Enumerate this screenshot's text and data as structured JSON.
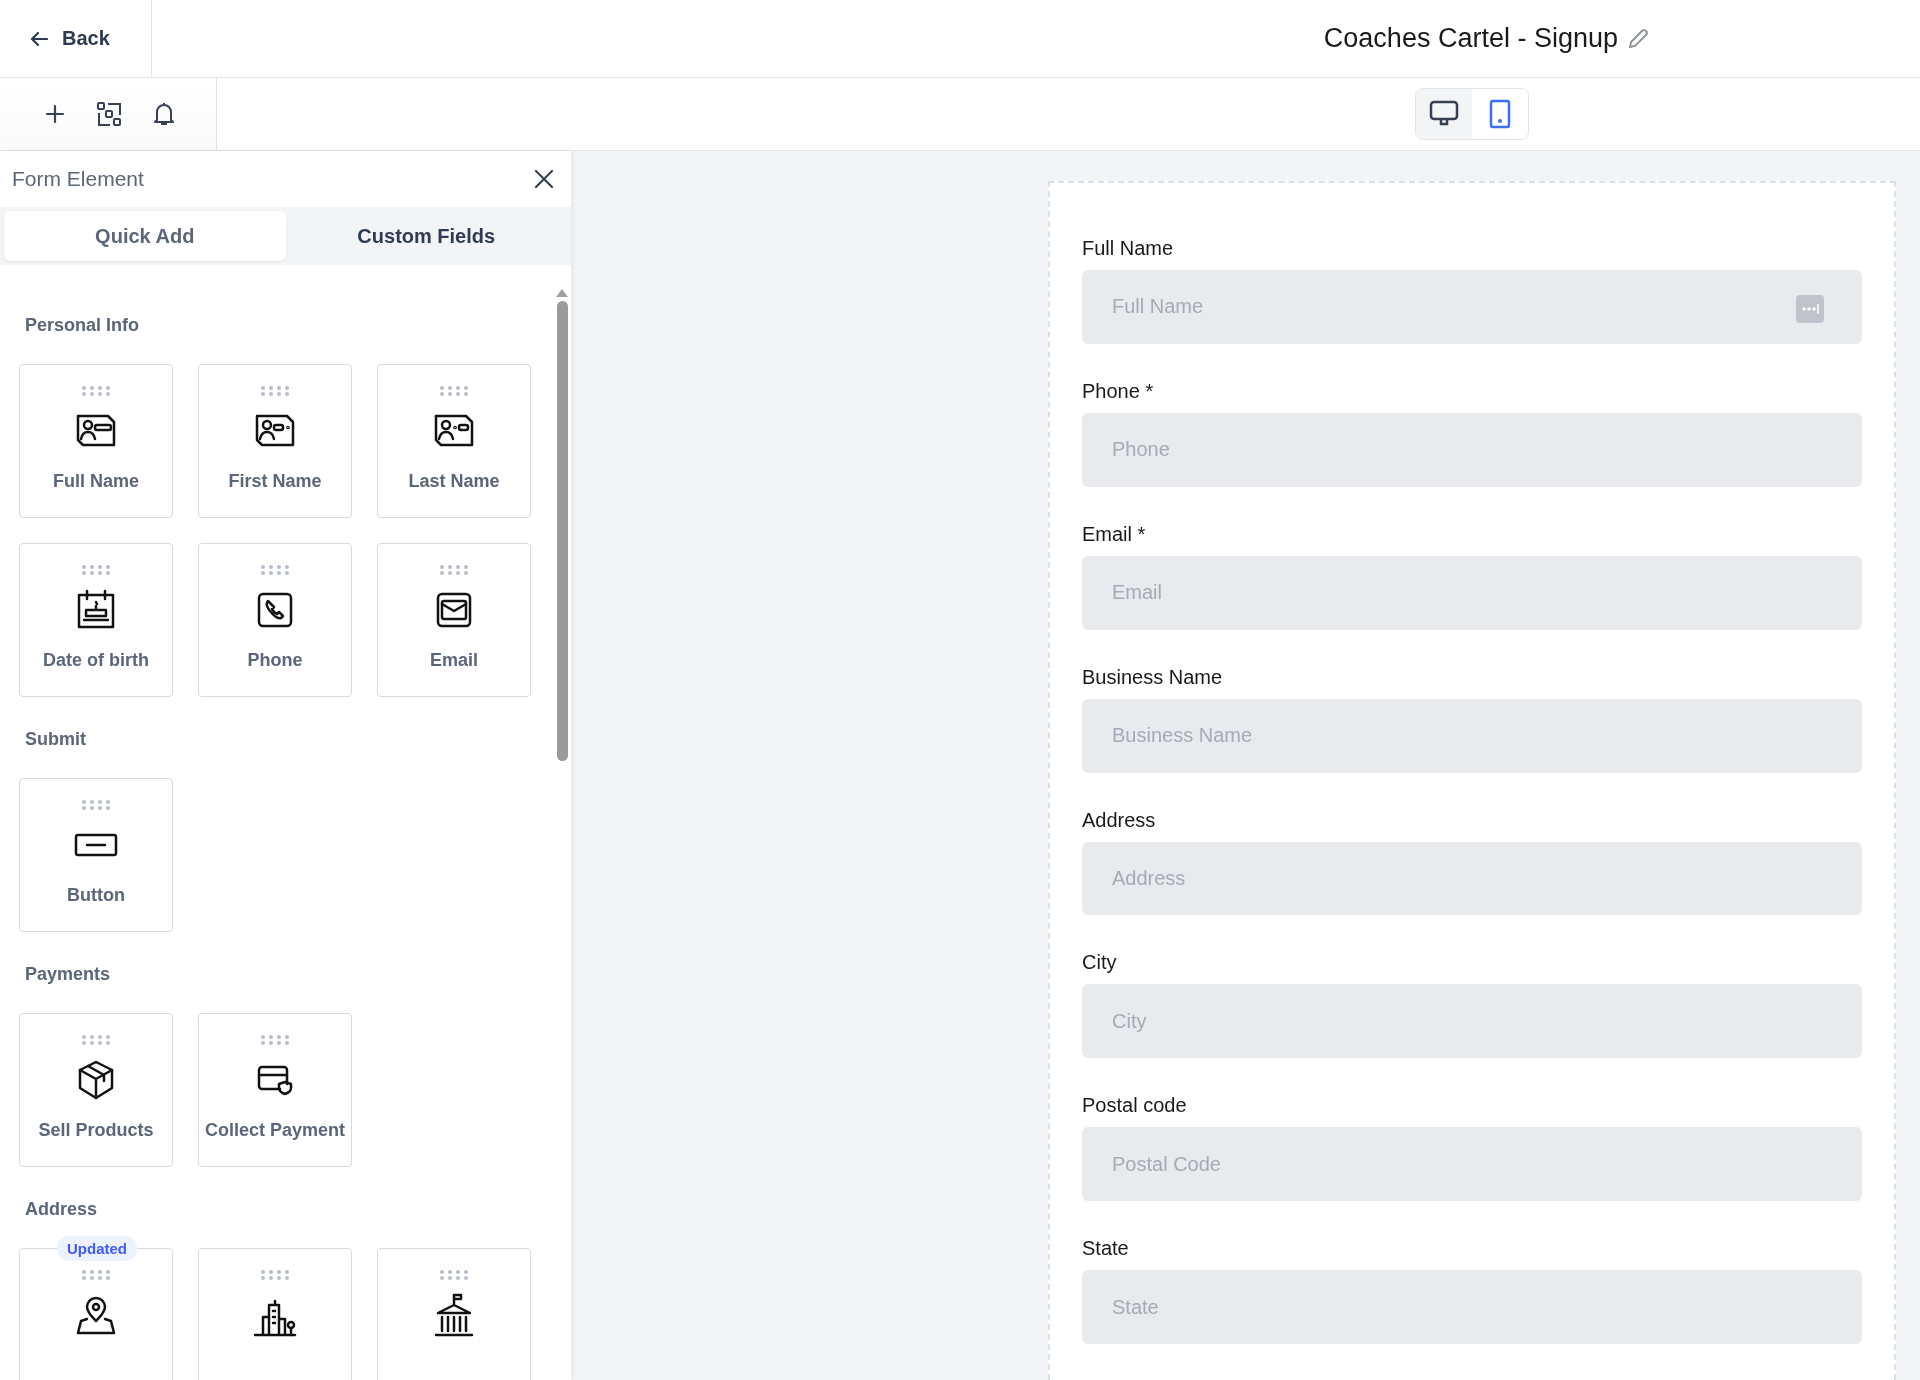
{
  "header": {
    "back_label": "Back",
    "title": "Coaches Cartel - Signup"
  },
  "toolbar": {
    "device_modes": [
      {
        "kind": "desktop",
        "selected": false
      },
      {
        "kind": "mobile",
        "selected": true
      }
    ]
  },
  "panel": {
    "title": "Form Element",
    "tabs": [
      {
        "label": "Quick Add",
        "selected": true
      },
      {
        "label": "Custom Fields",
        "selected": false
      }
    ],
    "sections": [
      {
        "title": "Personal Info",
        "items": [
          {
            "kind": "full-name",
            "label": "Full Name"
          },
          {
            "kind": "first-name",
            "label": "First Name"
          },
          {
            "kind": "last-name",
            "label": "Last Name"
          },
          {
            "kind": "birthday",
            "label": "Date of birth"
          },
          {
            "kind": "phone",
            "label": "Phone"
          },
          {
            "kind": "email",
            "label": "Email"
          }
        ]
      },
      {
        "title": "Submit",
        "items": [
          {
            "kind": "button",
            "label": "Button"
          }
        ]
      },
      {
        "title": "Payments",
        "items": [
          {
            "kind": "product",
            "label": "Sell Products"
          },
          {
            "kind": "payment",
            "label": "Collect Payment"
          }
        ]
      },
      {
        "title": "Address",
        "items": [
          {
            "kind": "location",
            "badge": "Updated"
          },
          {
            "kind": "city"
          },
          {
            "kind": "state"
          }
        ]
      }
    ]
  },
  "form": {
    "fields": [
      {
        "label": "Full Name",
        "placeholder": "Full Name",
        "has_menu": true
      },
      {
        "label": "Phone *",
        "placeholder": "Phone",
        "has_menu": false
      },
      {
        "label": "Email *",
        "placeholder": "Email",
        "has_menu": false
      },
      {
        "label": "Business Name",
        "placeholder": "Business Name",
        "has_menu": false
      },
      {
        "label": "Address",
        "placeholder": "Address",
        "has_menu": false
      },
      {
        "label": "City",
        "placeholder": "City",
        "has_menu": false
      },
      {
        "label": "Postal code",
        "placeholder": "Postal Code",
        "has_menu": false
      },
      {
        "label": "State",
        "placeholder": "State",
        "has_menu": false
      }
    ]
  }
}
